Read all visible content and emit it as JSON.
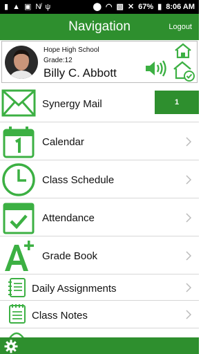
{
  "status_bar": {
    "battery": "67%",
    "time": "8:06 AM"
  },
  "app_bar": {
    "title": "Navigation",
    "logout_label": "Logout"
  },
  "profile": {
    "school": "Hope High School",
    "grade": "Grade:12",
    "name": "Billy C. Abbott"
  },
  "menu": {
    "items": [
      {
        "label": "Synergy Mail",
        "badge": "1"
      },
      {
        "label": "Calendar"
      },
      {
        "label": "Class Schedule"
      },
      {
        "label": "Attendance"
      },
      {
        "label": "Grade Book"
      },
      {
        "label": "Daily Assignments"
      },
      {
        "label": "Class Notes"
      }
    ]
  },
  "colors": {
    "brand_green": "#2e8f2e",
    "icon_green": "#3cb043"
  }
}
